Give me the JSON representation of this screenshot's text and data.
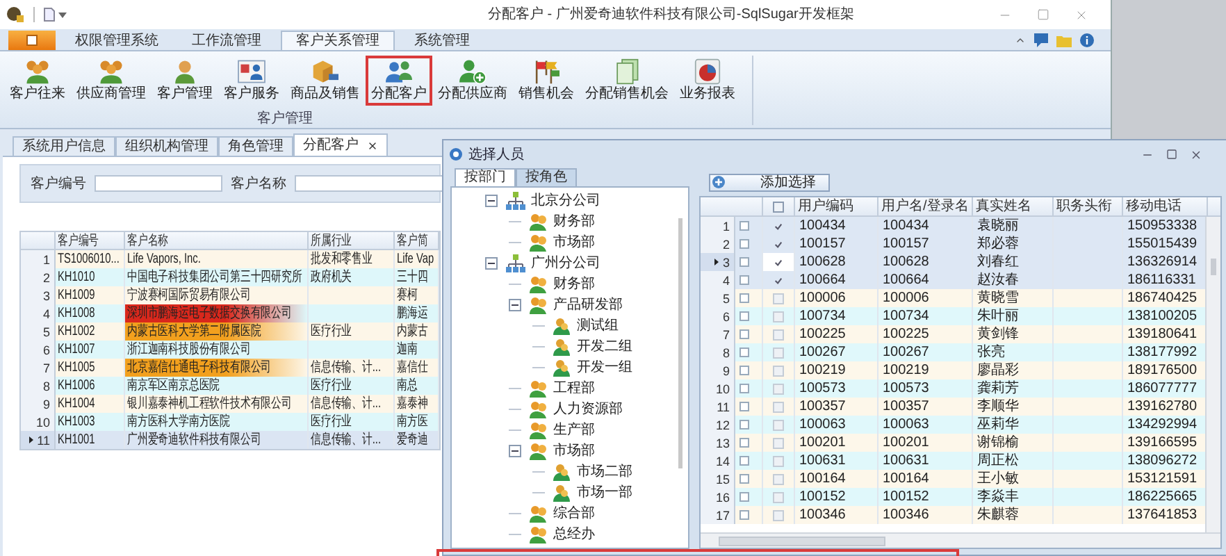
{
  "window": {
    "title": "分配客户 - 广州爱奇迪软件科技有限公司-SqlSugar开发框架"
  },
  "ribbon_tabs": [
    {
      "label": "权限管理系统",
      "selected": false
    },
    {
      "label": "工作流管理",
      "selected": false
    },
    {
      "label": "客户关系管理",
      "selected": true
    },
    {
      "label": "系统管理",
      "selected": false
    }
  ],
  "ribbon_buttons": [
    {
      "label": "客户往来",
      "kind": "people",
      "highlighted": false
    },
    {
      "label": "供应商管理",
      "kind": "people",
      "highlighted": false
    },
    {
      "label": "客户管理",
      "kind": "person",
      "highlighted": false
    },
    {
      "label": "客户服务",
      "kind": "card",
      "highlighted": false
    },
    {
      "label": "商品及销售",
      "kind": "box",
      "highlighted": false
    },
    {
      "label": "分配客户",
      "kind": "pair",
      "highlighted": true
    },
    {
      "label": "分配供应商",
      "kind": "person-add",
      "highlighted": false
    },
    {
      "label": "销售机会",
      "kind": "flags",
      "highlighted": false
    },
    {
      "label": "分配销售机会",
      "kind": "pages",
      "highlighted": false
    },
    {
      "label": "业务报表",
      "kind": "chart",
      "highlighted": false
    }
  ],
  "ribbon_group": "客户管理",
  "doc_tabs": [
    {
      "label": "系统用户信息",
      "selected": false,
      "closable": false
    },
    {
      "label": "组织机构管理",
      "selected": false,
      "closable": false
    },
    {
      "label": "角色管理",
      "selected": false,
      "closable": false
    },
    {
      "label": "分配客户",
      "selected": true,
      "closable": true
    }
  ],
  "search_fields": [
    {
      "label": "客户编号"
    },
    {
      "label": "客户名称"
    }
  ],
  "customer_table": {
    "columns": [
      "客户编号",
      "客户名称",
      "所属行业",
      "客户简"
    ],
    "rows": [
      {
        "index": "1",
        "code": "TS1006010...",
        "name": "Life Vapors, Inc.",
        "industry": "批发和零售业",
        "short": "Life Vap",
        "color": null,
        "current": false
      },
      {
        "index": "2",
        "code": "KH1010",
        "name": "中国电子科技集团公司第三十四研究所",
        "industry": "政府机关",
        "short": "三十四",
        "color": null,
        "current": false
      },
      {
        "index": "3",
        "code": "KH1009",
        "name": "宁波赛柯国际贸易有限公司",
        "industry": "",
        "short": "赛柯",
        "color": null,
        "current": false
      },
      {
        "index": "4",
        "code": "KH1008",
        "name": "深圳市鹏海运电子数据交换有限公司",
        "industry": "",
        "short": "鹏海运",
        "color": "#d9281c",
        "current": false
      },
      {
        "index": "5",
        "code": "KH1002",
        "name": "内蒙古医科大学第二附属医院",
        "industry": "医疗行业",
        "short": "内蒙古",
        "color": "#f2a01e",
        "current": false
      },
      {
        "index": "6",
        "code": "KH1007",
        "name": "浙江迦南科技股份有限公司",
        "industry": "",
        "short": "迦南",
        "color": null,
        "current": false
      },
      {
        "index": "7",
        "code": "KH1005",
        "name": "北京嘉信仕通电子科技有限公司",
        "industry": "信息传输、计...",
        "short": "嘉信仕",
        "color": "#f2a01e",
        "current": false
      },
      {
        "index": "8",
        "code": "KH1006",
        "name": "南京军区南京总医院",
        "industry": "医疗行业",
        "short": "南总",
        "color": null,
        "current": false
      },
      {
        "index": "9",
        "code": "KH1004",
        "name": "银川嘉泰神机工程软件技术有限公司",
        "industry": "信息传输、计...",
        "short": "嘉泰神",
        "color": null,
        "current": false
      },
      {
        "index": "10",
        "code": "KH1003",
        "name": "南方医科大学南方医院",
        "industry": "医疗行业",
        "short": "南方医",
        "color": null,
        "current": false
      },
      {
        "index": "11",
        "code": "KH1001",
        "name": "广州爱奇迪软件科技有限公司",
        "industry": "信息传输、计...",
        "short": "爱奇迪",
        "color": null,
        "current": true
      }
    ]
  },
  "dialog": {
    "title": "选择人员",
    "tabs": [
      {
        "label": "按部门",
        "selected": true
      },
      {
        "label": "按角色",
        "selected": false
      }
    ],
    "tree": [
      {
        "label": "北京分公司",
        "kind": "company",
        "expanded": true,
        "children": [
          {
            "label": "财务部",
            "kind": "department"
          },
          {
            "label": "市场部",
            "kind": "department"
          }
        ]
      },
      {
        "label": "广州分公司",
        "kind": "company",
        "expanded": true,
        "children": [
          {
            "label": "财务部",
            "kind": "department"
          },
          {
            "label": "产品研发部",
            "kind": "department",
            "expanded": true,
            "children": [
              {
                "label": "测试组",
                "kind": "group"
              },
              {
                "label": "开发二组",
                "kind": "group"
              },
              {
                "label": "开发一组",
                "kind": "group"
              }
            ]
          },
          {
            "label": "工程部",
            "kind": "department"
          },
          {
            "label": "人力资源部",
            "kind": "department"
          },
          {
            "label": "生产部",
            "kind": "department"
          },
          {
            "label": "市场部",
            "kind": "department",
            "expanded": true,
            "children": [
              {
                "label": "市场二部",
                "kind": "group"
              },
              {
                "label": "市场一部",
                "kind": "group"
              }
            ]
          },
          {
            "label": "综合部",
            "kind": "department"
          },
          {
            "label": "总经办",
            "kind": "department"
          }
        ]
      }
    ],
    "add_button": "添加选择",
    "select_all_checked": false,
    "columns": [
      "用户编码",
      "用户名/登录名",
      "真实姓名",
      "职务头衔",
      "移动电话"
    ],
    "rows": [
      {
        "index": "1",
        "checked": true,
        "current": false,
        "code": "100434",
        "login": "100434",
        "name": "袁晓丽",
        "phone": "150953338"
      },
      {
        "index": "2",
        "checked": true,
        "current": false,
        "code": "100157",
        "login": "100157",
        "name": "郑必蓉",
        "phone": "155015439"
      },
      {
        "index": "3",
        "checked": true,
        "current": true,
        "code": "100628",
        "login": "100628",
        "name": "刘春红",
        "phone": "136326914"
      },
      {
        "index": "4",
        "checked": true,
        "current": false,
        "code": "100664",
        "login": "100664",
        "name": "赵汝春",
        "phone": "186116331"
      },
      {
        "index": "5",
        "checked": false,
        "current": false,
        "code": "100006",
        "login": "100006",
        "name": "黄晓雪",
        "phone": "186740425"
      },
      {
        "index": "6",
        "checked": false,
        "current": false,
        "code": "100734",
        "login": "100734",
        "name": "朱叶丽",
        "phone": "138100205"
      },
      {
        "index": "7",
        "checked": false,
        "current": false,
        "code": "100225",
        "login": "100225",
        "name": "黄剑锋",
        "phone": "139180641"
      },
      {
        "index": "8",
        "checked": false,
        "current": false,
        "code": "100267",
        "login": "100267",
        "name": "张亮",
        "phone": "138177992"
      },
      {
        "index": "9",
        "checked": false,
        "current": false,
        "code": "100219",
        "login": "100219",
        "name": "廖晶彩",
        "phone": "189176500"
      },
      {
        "index": "10",
        "checked": false,
        "current": false,
        "code": "100573",
        "login": "100573",
        "name": "龚莉芳",
        "phone": "186077777"
      },
      {
        "index": "11",
        "checked": false,
        "current": false,
        "code": "100357",
        "login": "100357",
        "name": "李顺华",
        "phone": "139162780"
      },
      {
        "index": "12",
        "checked": false,
        "current": false,
        "code": "100063",
        "login": "100063",
        "name": "巫莉华",
        "phone": "134292994"
      },
      {
        "index": "13",
        "checked": false,
        "current": false,
        "code": "100201",
        "login": "100201",
        "name": "谢锦榆",
        "phone": "139166595"
      },
      {
        "index": "14",
        "checked": false,
        "current": false,
        "code": "100631",
        "login": "100631",
        "name": "周正松",
        "phone": "138096272"
      },
      {
        "index": "15",
        "checked": false,
        "current": false,
        "code": "100164",
        "login": "100164",
        "name": "王小敏",
        "phone": "153121591"
      },
      {
        "index": "16",
        "checked": false,
        "current": false,
        "code": "100152",
        "login": "100152",
        "name": "李焱丰",
        "phone": "186225665"
      },
      {
        "index": "17",
        "checked": false,
        "current": false,
        "code": "100346",
        "login": "100346",
        "name": "朱麒蓉",
        "phone": "137641853"
      }
    ]
  },
  "bottom_highlight": true
}
